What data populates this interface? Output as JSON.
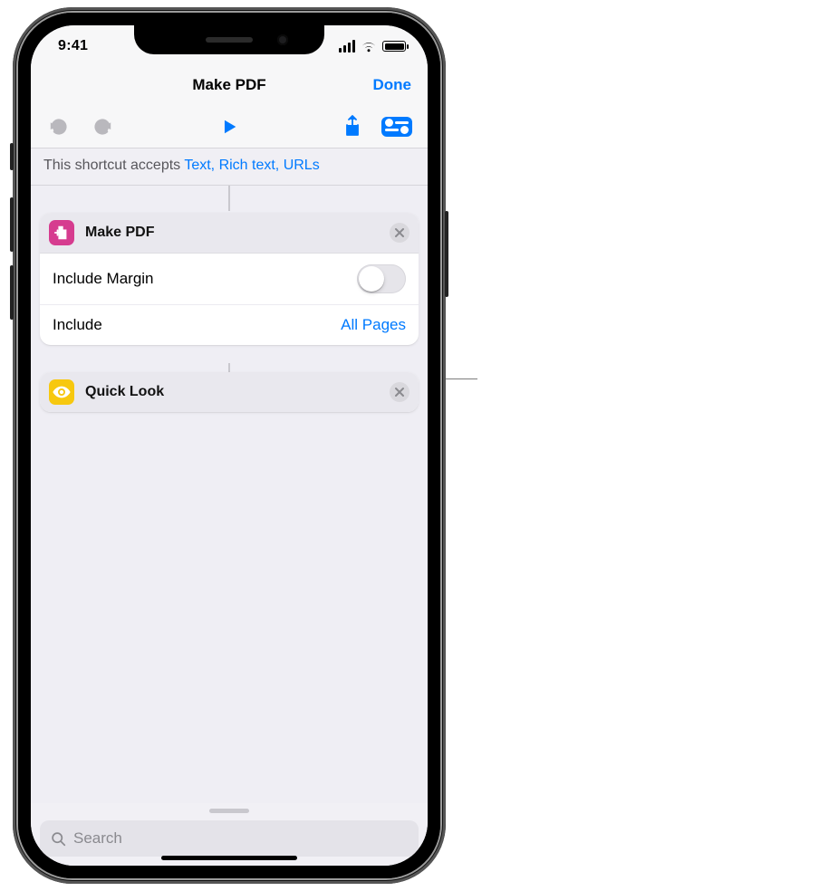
{
  "statusbar": {
    "time": "9:41"
  },
  "nav": {
    "title": "Make PDF",
    "done": "Done"
  },
  "accepts": {
    "prefix": "This shortcut accepts ",
    "types": "Text, Rich text, URLs"
  },
  "actions": {
    "makepdf": {
      "title": "Make PDF",
      "includeMarginLabel": "Include Margin",
      "includeMarginOn": false,
      "includeLabel": "Include",
      "includeValue": "All Pages"
    },
    "quicklook": {
      "title": "Quick Look"
    }
  },
  "search": {
    "placeholder": "Search"
  },
  "colors": {
    "accent": "#007aff"
  }
}
